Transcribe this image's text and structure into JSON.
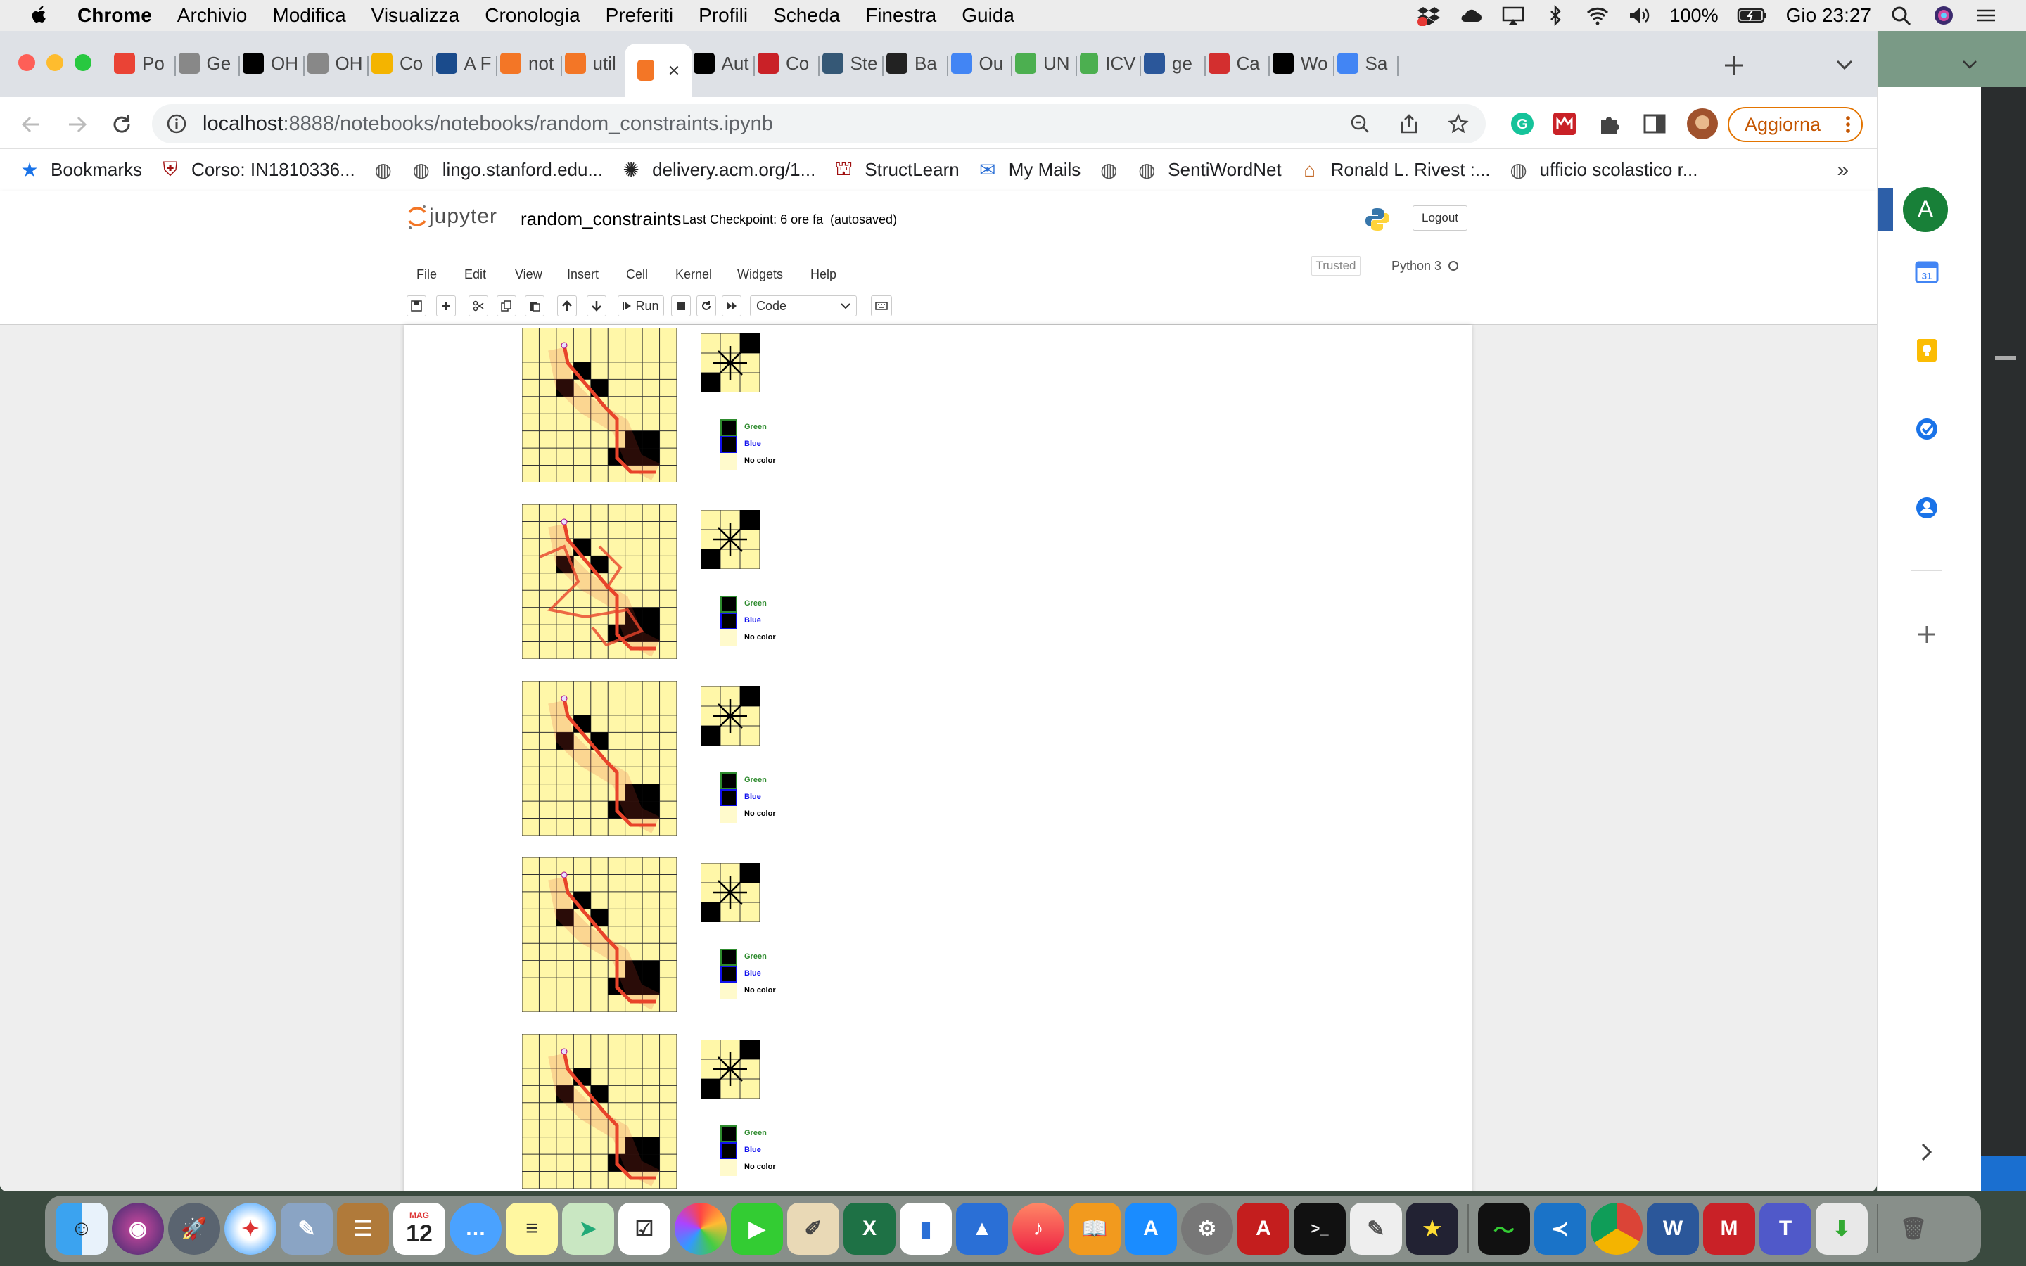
{
  "menubar": {
    "app": "Chrome",
    "items": [
      "Archivio",
      "Modifica",
      "Visualizza",
      "Cronologia",
      "Preferiti",
      "Profili",
      "Scheda",
      "Finestra",
      "Guida"
    ],
    "battery": "100%",
    "clock": "Gio 23:27"
  },
  "tabs": [
    {
      "icon": "gmail-icon",
      "label": "Po",
      "color": "#ea4335"
    },
    {
      "icon": "grid-icon",
      "label": "Ge",
      "color": "#888888"
    },
    {
      "icon": "github-icon",
      "label": "OH",
      "color": "#000000"
    },
    {
      "icon": "grid-icon",
      "label": "OH",
      "color": "#888888"
    },
    {
      "icon": "star-icon",
      "label": "Co",
      "color": "#f4b400"
    },
    {
      "icon": "ieee-icon",
      "label": "A F",
      "color": "#1a4b8c"
    },
    {
      "icon": "jupyter-icon",
      "label": "not",
      "color": "#f37626"
    },
    {
      "icon": "notebook-icon",
      "label": "util",
      "color": "#f37626"
    },
    {
      "icon": "notebook-icon",
      "label": "",
      "color": "#f37626"
    },
    {
      "icon": "n-icon",
      "label": "Aut",
      "color": "#000000"
    },
    {
      "icon": "mendeley-icon",
      "label": "Co",
      "color": "#c92127"
    },
    {
      "icon": "tds-icon",
      "label": "Ste",
      "color": "#355876"
    },
    {
      "icon": "star-dark-icon",
      "label": "Ba",
      "color": "#222222"
    },
    {
      "icon": "google-icon",
      "label": "Ou",
      "color": "#4285f4"
    },
    {
      "icon": "leaf-icon",
      "label": "UN",
      "color": "#4caf50"
    },
    {
      "icon": "leaf-icon",
      "label": "ICV",
      "color": "#4caf50"
    },
    {
      "icon": "word-icon",
      "label": "ge",
      "color": "#2b579a"
    },
    {
      "icon": "acrobat-icon",
      "label": "Ca",
      "color": "#d32f2f"
    },
    {
      "icon": "w-icon",
      "label": "Wo",
      "color": "#000000"
    },
    {
      "icon": "google-icon",
      "label": "Sa",
      "color": "#4285f4"
    }
  ],
  "address": {
    "url_host": "localhost",
    "url_rest": ":8888/notebooks/notebooks/random_constraints.ipynb",
    "update_button": "Aggiorna",
    "ghost_update": "giorna"
  },
  "bookmarks": [
    {
      "icon": "star-icon",
      "label": "Bookmarks"
    },
    {
      "icon": "shield-icon",
      "label": "Corso: IN1810336..."
    },
    {
      "icon": "globe-icon",
      "label": ""
    },
    {
      "icon": "globe-icon",
      "label": "lingo.stanford.edu..."
    },
    {
      "icon": "acm-icon",
      "label": "delivery.acm.org/1..."
    },
    {
      "icon": "penn-icon",
      "label": "StructLearn"
    },
    {
      "icon": "mail-icon",
      "label": "My Mails"
    },
    {
      "icon": "globe-icon",
      "label": ""
    },
    {
      "icon": "globe-icon",
      "label": "SentiWordNet"
    },
    {
      "icon": "page-icon",
      "label": "Ronald L. Rivest :..."
    },
    {
      "icon": "globe-icon",
      "label": "ufficio scolastico r..."
    }
  ],
  "jupyter": {
    "logo": "jupyter",
    "title": "random_constraints",
    "checkpoint": "Last Checkpoint: 6 ore fa",
    "autosaved": "(autosaved)",
    "logout": "Logout",
    "menus": [
      "File",
      "Edit",
      "View",
      "Insert",
      "Cell",
      "Kernel",
      "Widgets",
      "Help"
    ],
    "trusted": "Trusted",
    "kernel": "Python 3",
    "run": "Run",
    "cell_type": "Code"
  },
  "outputs": {
    "legend": [
      "Green",
      "Blue",
      "No color"
    ],
    "colors": {
      "grid": "#fff7a8",
      "path": "#e8432a",
      "green": "#2e8b2e",
      "blue": "#1010ee"
    }
  },
  "side_avatar": "A"
}
